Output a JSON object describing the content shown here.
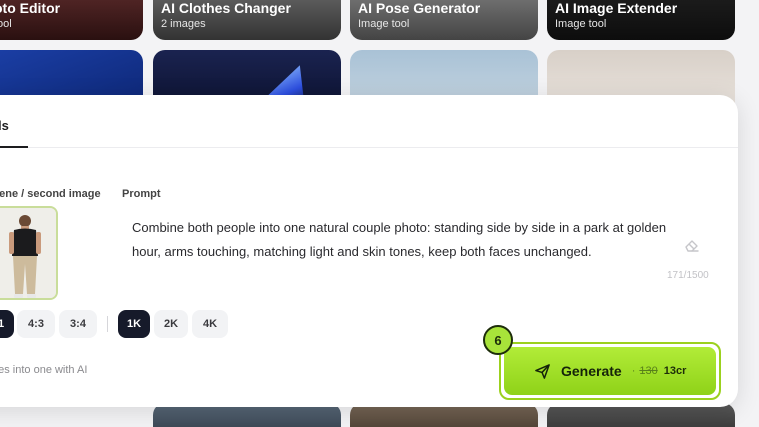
{
  "gallery": {
    "top_cards": [
      {
        "title": "oto Editor",
        "subtitle": "tool"
      },
      {
        "title": "AI Clothes Changer",
        "subtitle": "2 images"
      },
      {
        "title": "AI Pose Generator",
        "subtitle": "Image tool"
      },
      {
        "title": "AI Image Extender",
        "subtitle": "Image tool"
      }
    ]
  },
  "panel": {
    "tab_label": "ls",
    "scene_label": "cene / second image",
    "prompt_label": "Prompt",
    "prompt_text": "Combine both people into one natural couple photo: standing side by side in a park at golden hour, arms touching, matching light and skin tones, keep both faces unchanged.",
    "char_count": "171/1500",
    "aspect_options": [
      "1",
      "4:3",
      "3:4"
    ],
    "aspect_selected": "1",
    "quality_options": [
      "1K",
      "2K",
      "4K"
    ],
    "quality_selected": "1K",
    "description": "ges into one with AI"
  },
  "generate": {
    "label": "Generate",
    "dot": "·",
    "old_cost": "130",
    "cost": "13cr",
    "step_badge": "6",
    "accent": "#9bd11e"
  },
  "icons": {
    "eraser": "eraser-icon",
    "send": "send-icon"
  }
}
